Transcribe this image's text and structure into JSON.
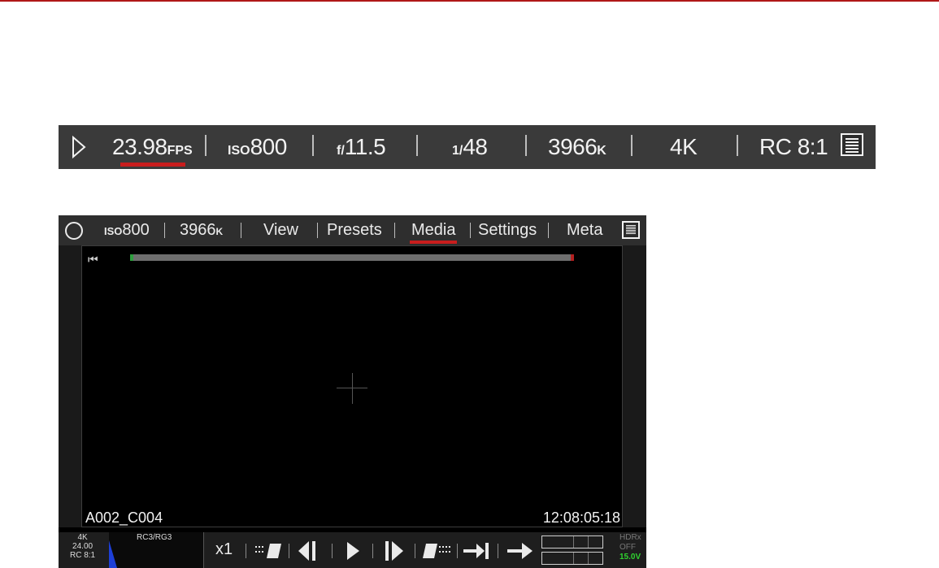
{
  "status_bar": {
    "play_icon": "play-outline-icon",
    "fps_value": "23.98",
    "fps_unit": "FPS",
    "iso_label": "ISO",
    "iso_value": "800",
    "fstop_label": "f/",
    "fstop_value": "11.5",
    "shutter_label": "1/",
    "shutter_value": "48",
    "kelvin_value": "3966",
    "kelvin_unit": "K",
    "resolution": "4K",
    "compression": "RC 8:1",
    "menu_icon": "menu-list-icon",
    "accent_color": "#c81d1d"
  },
  "monitor": {
    "top_bar": {
      "record_icon": "record-circle-icon",
      "iso_label": "ISO",
      "iso_value": "800",
      "kelvin_value": "3966",
      "kelvin_unit": "K",
      "tabs": [
        {
          "label": "View",
          "active": false
        },
        {
          "label": "Presets",
          "active": false
        },
        {
          "label": "Media",
          "active": true
        },
        {
          "label": "Settings",
          "active": false
        },
        {
          "label": "Meta",
          "active": false
        }
      ],
      "menu_icon": "menu-list-icon"
    },
    "clip_name": "A002_C004",
    "timecode": "12:08:05:18",
    "bottom_bar": {
      "res": "4K",
      "fps": "24.00",
      "compression": "RC 8:1",
      "histogram_label": "RC3/RG3",
      "speed": "x1",
      "hdrx": "HDRx",
      "hdrx_state": "OFF",
      "voltage": "15.0V",
      "voltage_color": "#2fd22f"
    }
  }
}
